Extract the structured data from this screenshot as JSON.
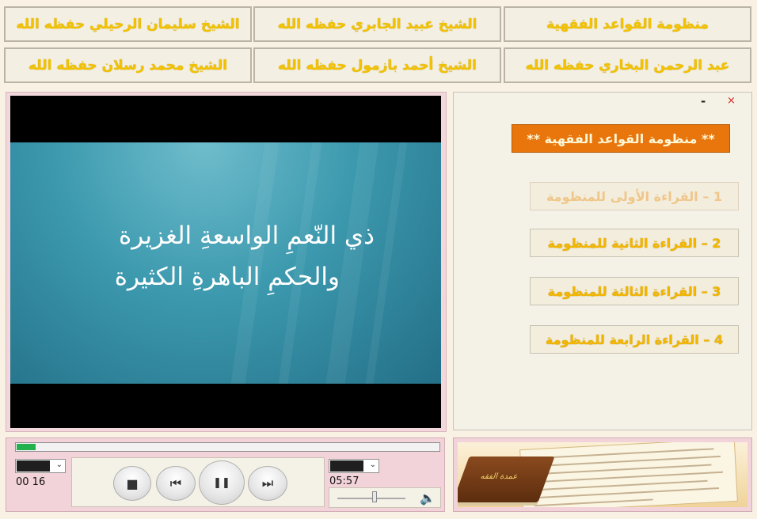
{
  "nav": {
    "row1": [
      {
        "label": "منظومة القواعد الفقهية",
        "muted": true
      },
      {
        "label": "الشيخ عبيد الجابري حفظه الله"
      },
      {
        "label": "الشيخ سليمان الرحيلي حفظه الله"
      }
    ],
    "row2": [
      {
        "label": "عبد الرحمن البخاري حفظه الله"
      },
      {
        "label": "الشيخ أحمد بازمول حفظه الله"
      },
      {
        "label": "الشيخ محمد رسلان حفظه الله"
      }
    ]
  },
  "video": {
    "subtitle_line1": "ذي النّعمِ الواسعةِ الغزيرة",
    "subtitle_line2": "والحكمِ الباهرةِ الكثيرة"
  },
  "panel": {
    "minimize": "-",
    "close": "×",
    "title": "** منظومة القواعد الفقهية **",
    "readings": [
      {
        "label": "1 – القراءة الأولى للمنظومة",
        "faded": true
      },
      {
        "label": "2 – القراءة الثانية للمنظومة"
      },
      {
        "label": "3 – القراءة الثالثة للمنظومة"
      },
      {
        "label": "4 – القراءة الرابعة للمنظومة"
      }
    ]
  },
  "player": {
    "elapsed": "00 16",
    "duration": "05:57",
    "progress_fraction": 0.045,
    "volume_fraction": 0.55,
    "icons": {
      "stop": "stop-icon",
      "prev": "previous-icon",
      "pause": "pause-icon",
      "next": "next-icon",
      "volume": "speaker-icon"
    },
    "glyphs": {
      "stop": "■",
      "prev": "⏮",
      "pause": "❚❚",
      "next": "⏭",
      "volume": "🔈",
      "arrow": "⌄"
    }
  },
  "banner": {
    "book_title": "عمدة الفقه"
  }
}
